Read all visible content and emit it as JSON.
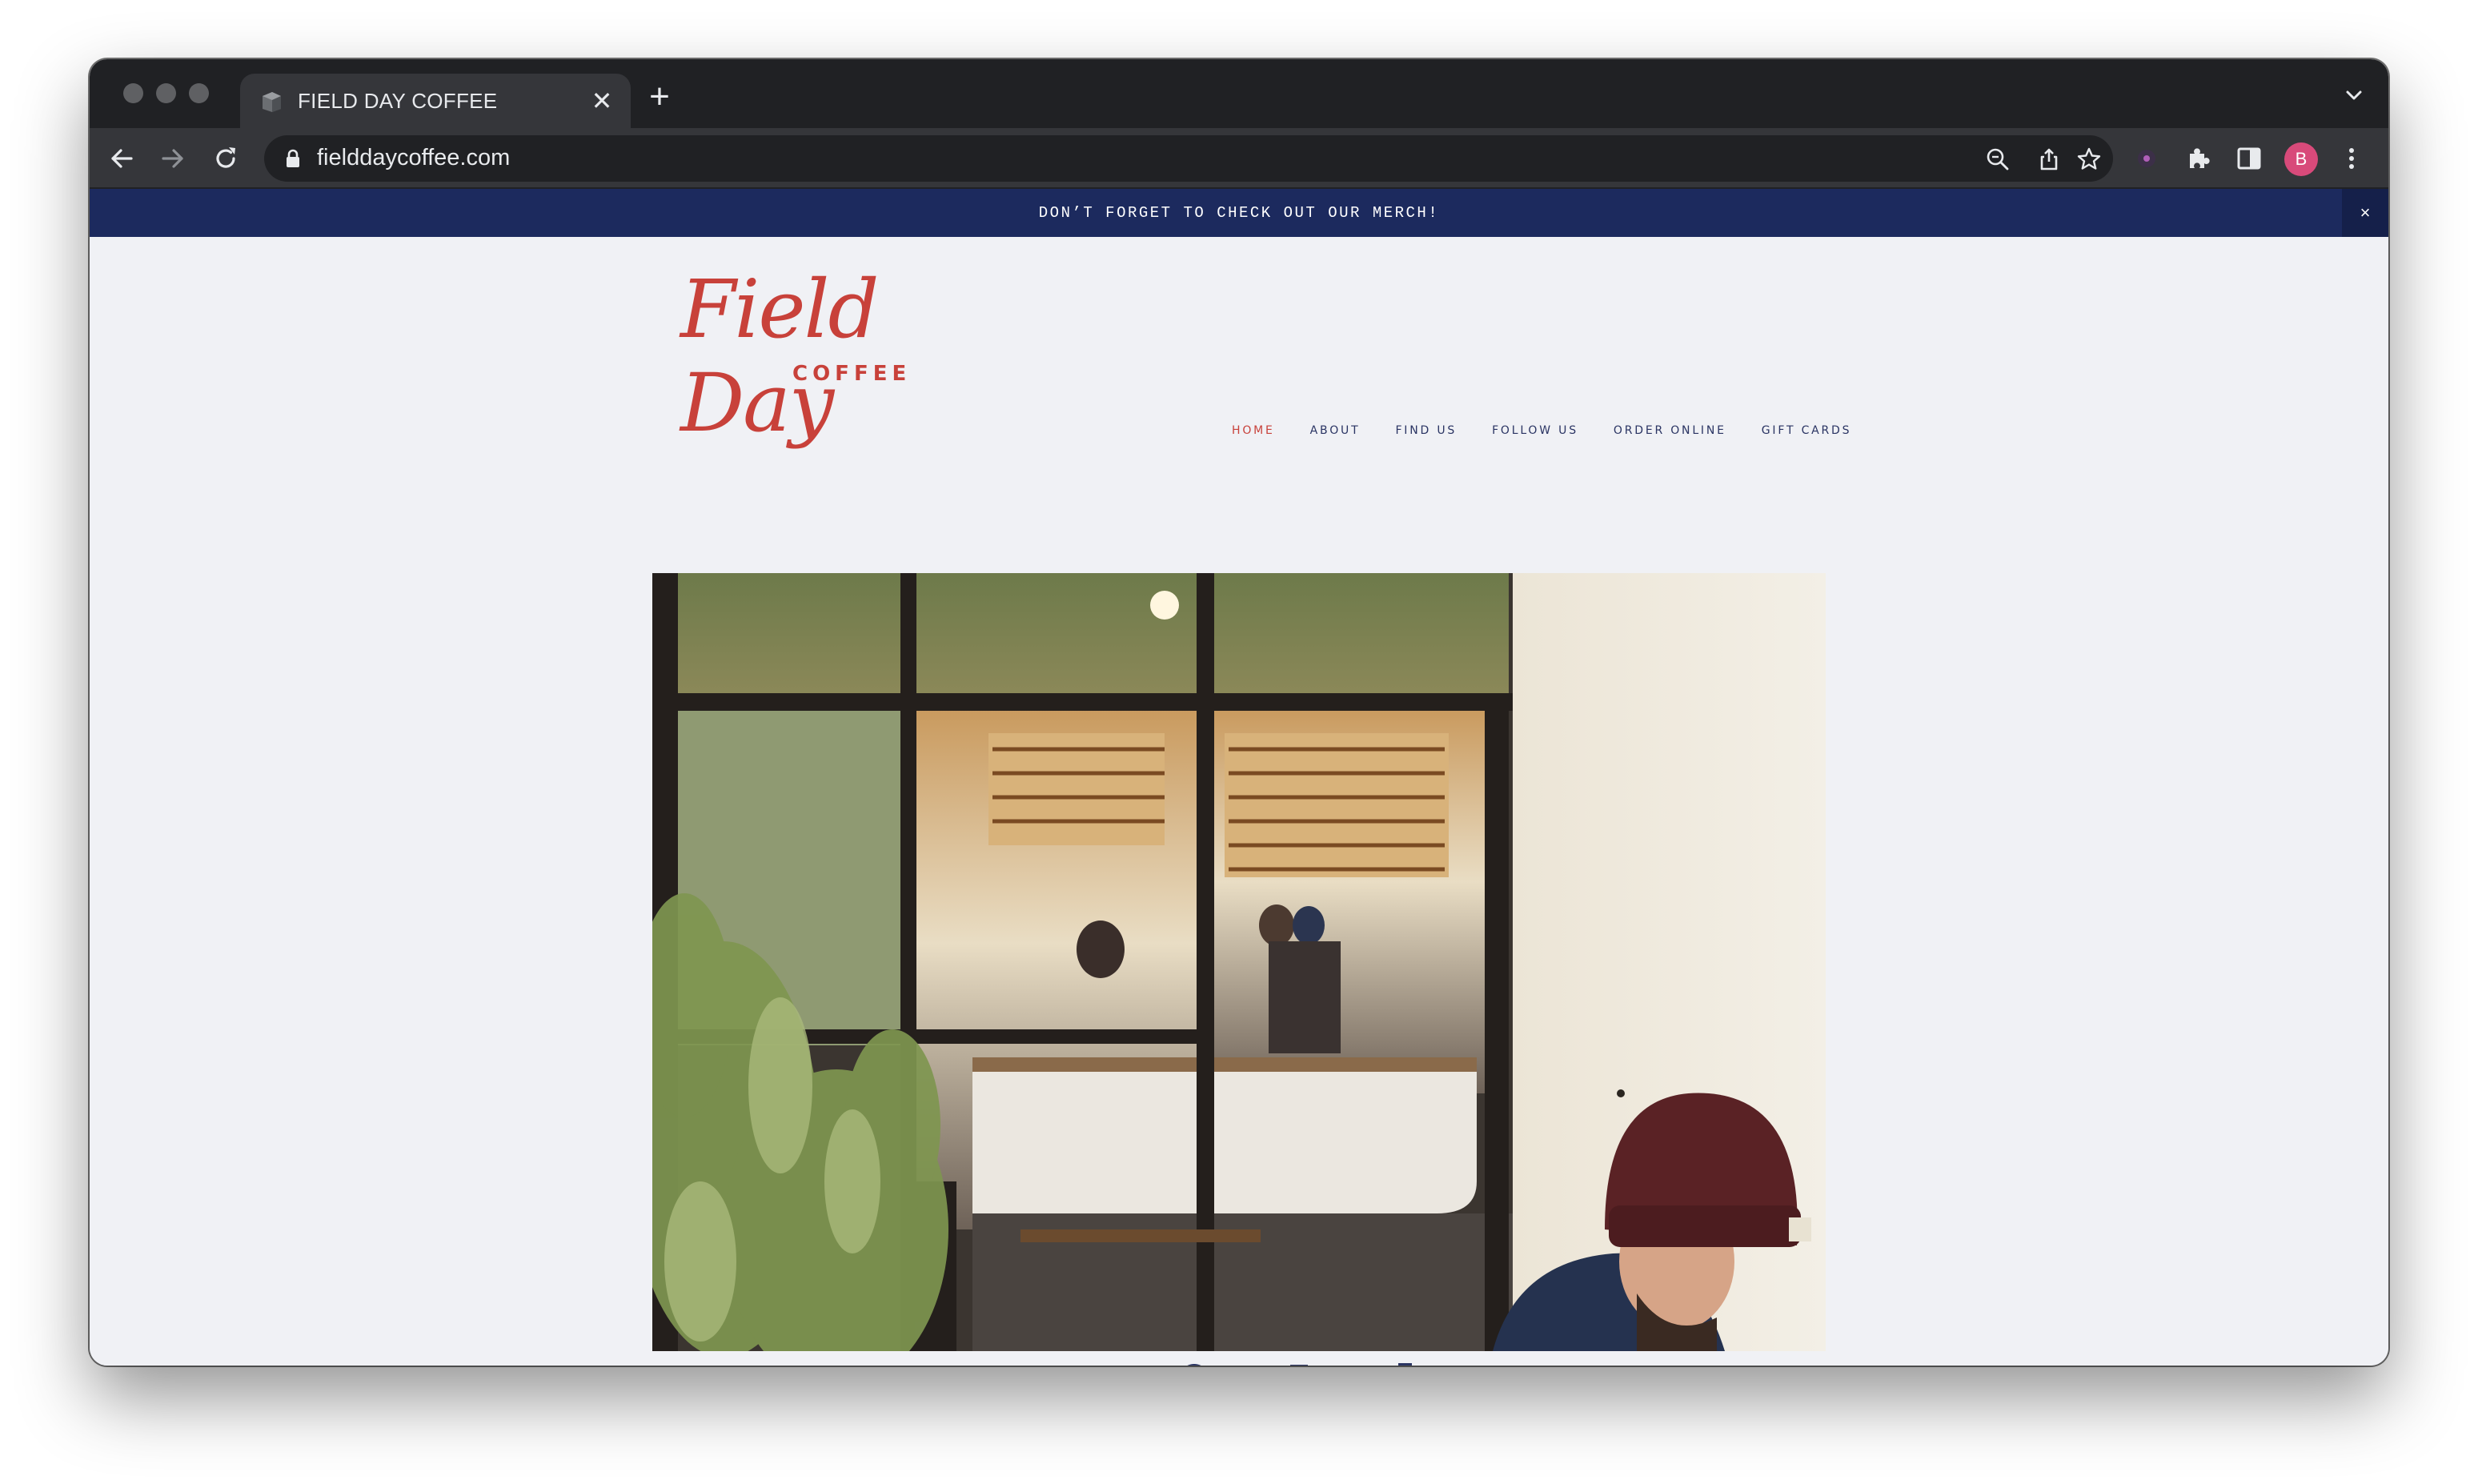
{
  "browser": {
    "tab": {
      "title": "FIELD DAY COFFEE",
      "close_glyph": "✕"
    },
    "new_tab_glyph": "+",
    "address": {
      "url": "fielddaycoffee.com"
    },
    "profile_initial": "B",
    "icons": [
      "back-arrow-icon",
      "forward-arrow-icon",
      "reload-icon",
      "lock-icon",
      "zoom-icon",
      "share-icon",
      "bookmark-star-icon",
      "extension-dot-icon",
      "puzzle-extensions-icon",
      "side-panel-icon",
      "kebab-menu-icon",
      "tab-list-chevron-icon"
    ]
  },
  "announcement": {
    "text": "DON’T FORGET TO CHECK OUT OUR MERCH!",
    "close_glyph": "×",
    "bg_color": "#1c2a5e"
  },
  "site": {
    "logo": {
      "word": "Field Day",
      "sub": "COFFEE"
    },
    "nav": [
      {
        "label": "HOME",
        "active": true
      },
      {
        "label": "ABOUT",
        "active": false
      },
      {
        "label": "FIND US",
        "active": false
      },
      {
        "label": "FOLLOW US",
        "active": false
      },
      {
        "label": "ORDER ONLINE",
        "active": false
      },
      {
        "label": "GIFT CARDS",
        "active": false
      }
    ],
    "accent_color": "#c8413a",
    "nav_color": "#2a3463"
  }
}
